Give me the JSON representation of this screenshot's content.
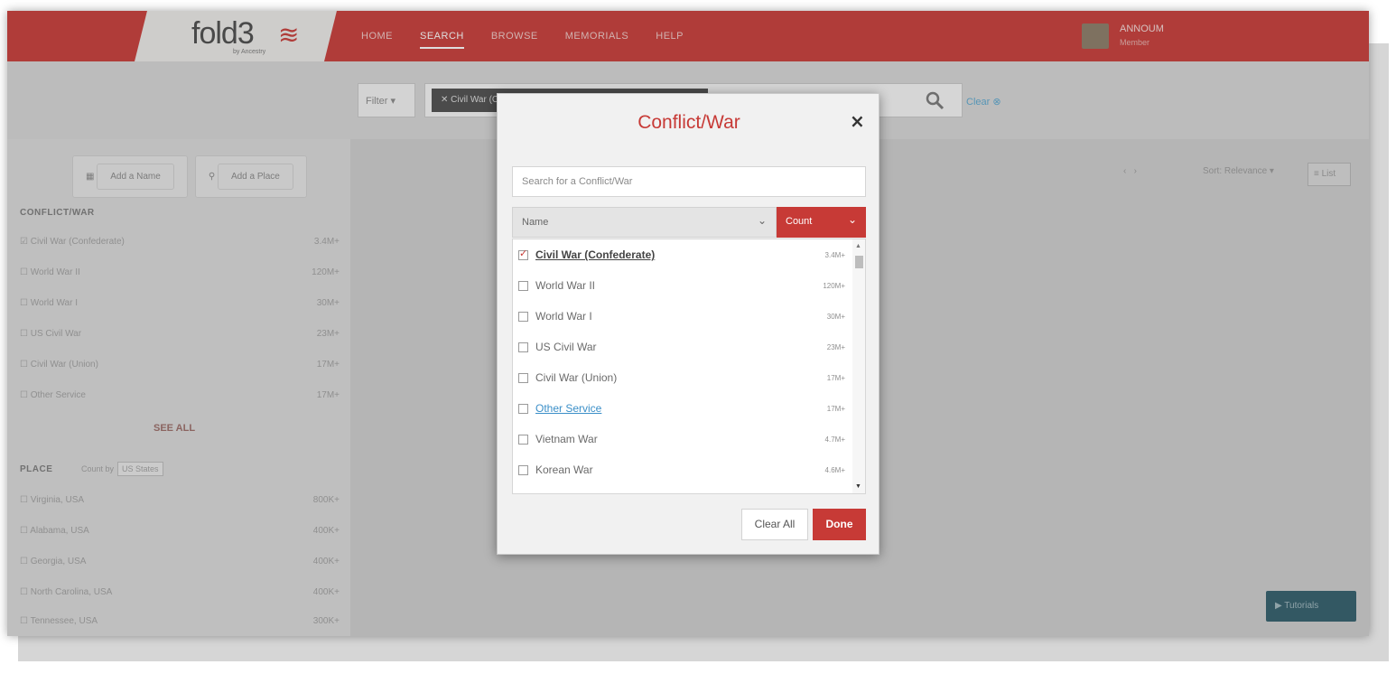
{
  "header": {
    "logo": "fold3",
    "logo_sub": "by Ancestry",
    "nav": [
      "HOME",
      "SEARCH",
      "BROWSE",
      "MEMORIALS",
      "HELP"
    ],
    "user_name": "ANNOUM",
    "user_sub": "Member"
  },
  "searchbar": {
    "filter_label": "Filter",
    "tag_label": "Civil War (Confederate)",
    "clear_label": "Clear"
  },
  "sidebar": {
    "add_name": "Add a Name",
    "add_place": "Add a Place",
    "conflict_heading": "CONFLICT/WAR",
    "conflicts": [
      {
        "name": "Civil War (Confederate)",
        "count": "3.4M+"
      },
      {
        "name": "World War II",
        "count": "120M+"
      },
      {
        "name": "World War I",
        "count": "30M+"
      },
      {
        "name": "US Civil War",
        "count": "23M+"
      },
      {
        "name": "Civil War (Union)",
        "count": "17M+"
      },
      {
        "name": "Other Service",
        "count": "17M+"
      }
    ],
    "see_all": "SEE ALL",
    "place_heading": "PLACE",
    "place_option_a": "Count by",
    "place_option_b": "US States",
    "places": [
      {
        "name": "Virginia, USA",
        "count": "800K+"
      },
      {
        "name": "Alabama, USA",
        "count": "400K+"
      },
      {
        "name": "Georgia, USA",
        "count": "400K+"
      },
      {
        "name": "North Carolina, USA",
        "count": "400K+"
      },
      {
        "name": "Tennessee, USA",
        "count": "300K+"
      }
    ]
  },
  "main": {
    "sort_label": "Sort: Relevance",
    "list_label": "List",
    "tutorials_label": "Tutorials"
  },
  "modal": {
    "title": "Conflict/War",
    "close": "×",
    "search_placeholder": "Search for a Conflict/War",
    "sort_name": "Name",
    "sort_count": "Count",
    "items": [
      {
        "name": "Civil War (Confederate)",
        "count": "3.4M+",
        "checked": true
      },
      {
        "name": "World War II",
        "count": "120M+",
        "checked": false
      },
      {
        "name": "World War I",
        "count": "30M+",
        "checked": false
      },
      {
        "name": "US Civil War",
        "count": "23M+",
        "checked": false
      },
      {
        "name": "Civil War (Union)",
        "count": "17M+",
        "checked": false
      },
      {
        "name": "Other Service",
        "count": "17M+",
        "checked": false
      },
      {
        "name": "Vietnam War",
        "count": "4.7M+",
        "checked": false
      },
      {
        "name": "Korean War",
        "count": "4.6M+",
        "checked": false
      }
    ],
    "clear_all": "Clear All",
    "done": "Done"
  },
  "colors": {
    "brand_red": "#c73a36",
    "link_blue": "#3b8fc8"
  }
}
